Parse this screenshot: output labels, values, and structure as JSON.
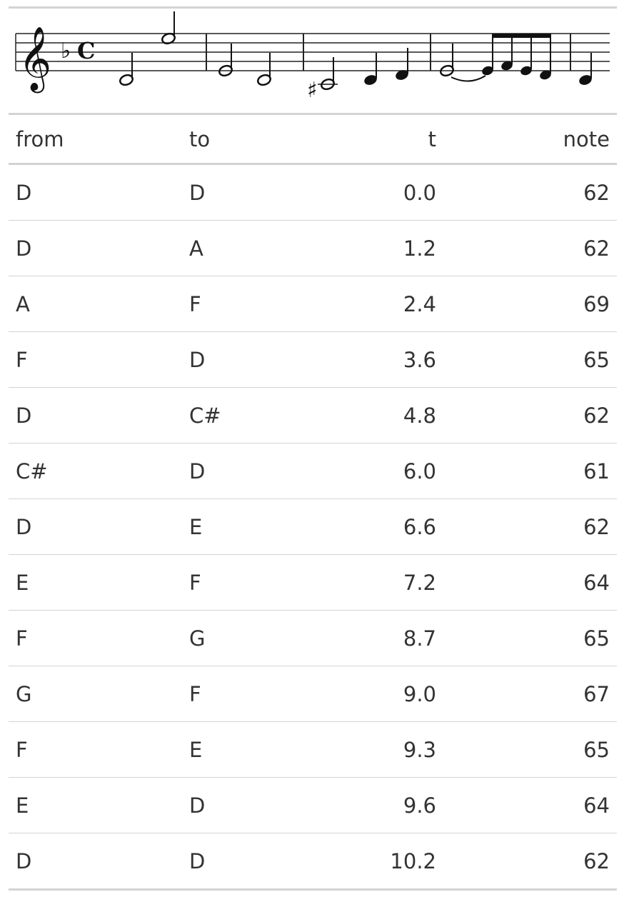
{
  "table": {
    "headers": [
      "from",
      "to",
      "t",
      "note"
    ],
    "rows": [
      [
        "D",
        "D",
        "0.0",
        "62"
      ],
      [
        "D",
        "A",
        "1.2",
        "62"
      ],
      [
        "A",
        "F",
        "2.4",
        "69"
      ],
      [
        "F",
        "D",
        "3.6",
        "65"
      ],
      [
        "D",
        "C#",
        "4.8",
        "62"
      ],
      [
        "C#",
        "D",
        "6.0",
        "61"
      ],
      [
        "D",
        "E",
        "6.6",
        "62"
      ],
      [
        "E",
        "F",
        "7.2",
        "64"
      ],
      [
        "F",
        "G",
        "8.7",
        "65"
      ],
      [
        "G",
        "F",
        "9.0",
        "67"
      ],
      [
        "F",
        "E",
        "9.3",
        "65"
      ],
      [
        "E",
        "D",
        "9.6",
        "64"
      ],
      [
        "D",
        "D",
        "10.2",
        "62"
      ]
    ]
  },
  "score": {
    "clef": "treble-clef-icon",
    "key_signature": "flat",
    "time_signature": "common-time",
    "notes": [
      "D",
      "A",
      "F",
      "D",
      "C#",
      "D",
      "E",
      "F",
      "F",
      "G",
      "F",
      "E",
      "D"
    ]
  }
}
